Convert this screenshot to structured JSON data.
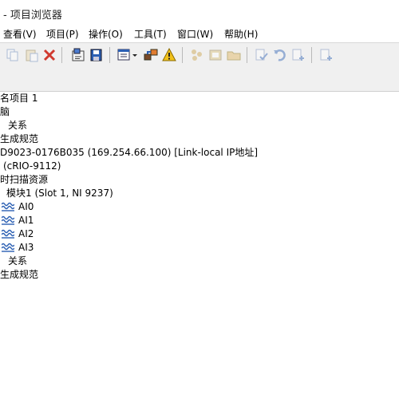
{
  "window": {
    "title": "- 项目浏览器"
  },
  "menu": {
    "items": [
      {
        "label": "查看(V)"
      },
      {
        "label": "项目(P)"
      },
      {
        "label": "操作(O)"
      },
      {
        "label": "工具(T)"
      },
      {
        "label": "窗口(W)"
      },
      {
        "label": "帮助(H)"
      }
    ]
  },
  "tree": {
    "rows": [
      {
        "label": "名项目 1"
      },
      {
        "label": "脑"
      },
      {
        "label": "关系"
      },
      {
        "label": "生成规范"
      },
      {
        "label": "D9023-0176B035 (169.254.66.100) [Link-local IP地址]"
      },
      {
        "label": "(cRIO-9112)"
      },
      {
        "label": "时扫描资源"
      },
      {
        "label": "模块1 (Slot 1, NI 9237)"
      },
      {
        "label": "AI0",
        "icon": "analog-channel-icon"
      },
      {
        "label": "AI1",
        "icon": "analog-channel-icon"
      },
      {
        "label": "AI2",
        "icon": "analog-channel-icon"
      },
      {
        "label": "AI3",
        "icon": "analog-channel-icon"
      },
      {
        "label": "关系"
      },
      {
        "label": "生成规范"
      }
    ]
  },
  "colors": {
    "toolbar_bg": "#f0f0f0",
    "icon_blue": "#2b5fb3",
    "icon_red": "#d03a2f",
    "icon_yellow": "#f2c21b"
  }
}
